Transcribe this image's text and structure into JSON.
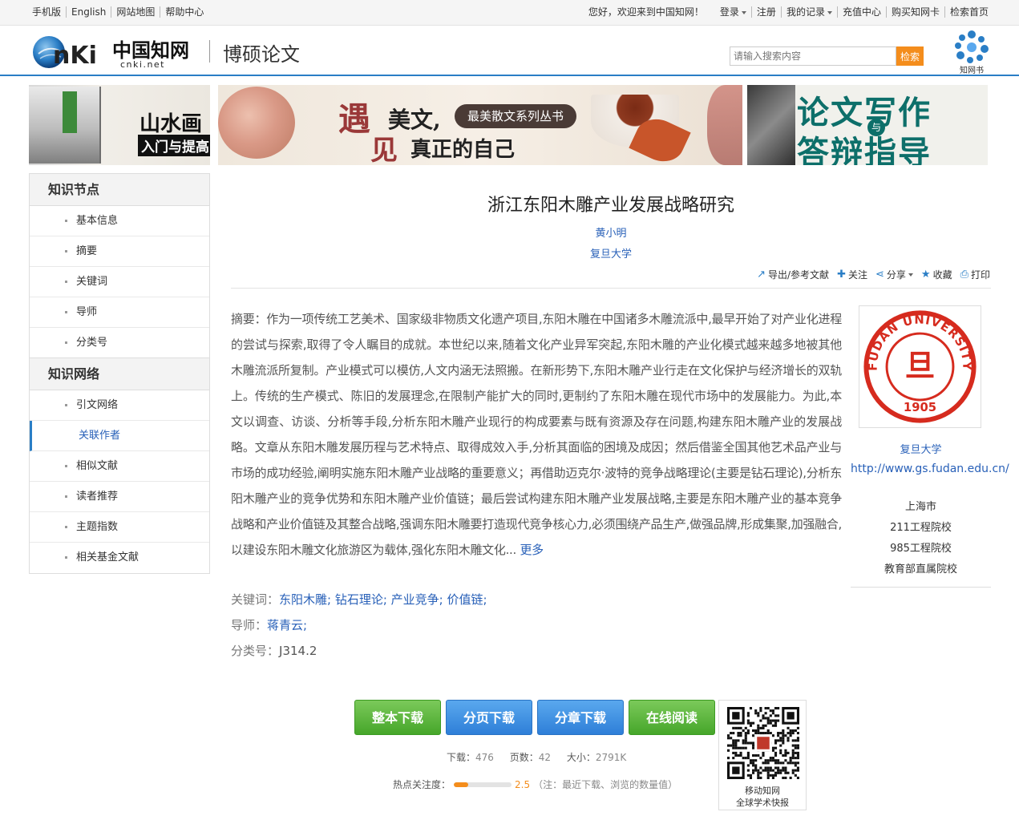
{
  "topbar": {
    "left_links": [
      "手机版",
      "English",
      "网站地图",
      "帮助中心"
    ],
    "greeting": "您好，欢迎来到中国知网！",
    "right_links": [
      {
        "label": "登录",
        "dropdown": true
      },
      {
        "label": "注册",
        "dropdown": false
      },
      {
        "label": "我的记录",
        "dropdown": true
      },
      {
        "label": "充值中心",
        "dropdown": false
      },
      {
        "label": "购买知网卡",
        "dropdown": false
      },
      {
        "label": "检索首页",
        "dropdown": false
      }
    ]
  },
  "header": {
    "logo_text": "CNKi中国知网",
    "logo_sub": "cnki.net",
    "section_title": "博硕论文",
    "search_placeholder": "请输入搜索内容",
    "search_button": "检索",
    "app_logo_text": "知网书"
  },
  "banners": {
    "b1_title": "山水画",
    "b1_sub": "入门与提高",
    "b2_yu": "遇",
    "b2_mw": "美文,",
    "b2_jian": "见",
    "b2_zj": "真正的自己",
    "b2_tag": "最美散文系列丛书",
    "b3_line1": "论文写作",
    "b3_line2": "答辩指导",
    "b3_yu": "与"
  },
  "nav": {
    "group1": "知识节点",
    "group1_items": [
      "基本信息",
      "摘要",
      "关键词",
      "导师",
      "分类号"
    ],
    "group2": "知识网络",
    "group2_items": [
      "引文网络",
      "关联作者",
      "相似文献",
      "读者推荐",
      "主题指数",
      "相关基金文献"
    ],
    "active": "关联作者"
  },
  "article": {
    "title": "浙江东阳木雕产业发展战略研究",
    "author": "黄小明",
    "org": "复旦大学",
    "tools": [
      "导出/参考文献",
      "关注",
      "分享",
      "收藏",
      "打印"
    ],
    "abstract_label": "摘要：",
    "abstract": "作为一项传统工艺美术、国家级非物质文化遗产项目,东阳木雕在中国诸多木雕流派中,最早开始了对产业化进程的尝试与探索,取得了令人瞩目的成就。本世纪以来,随着文化产业异军突起,东阳木雕的产业化模式越来越多地被其他木雕流派所复制。产业模式可以模仿,人文内涵无法照搬。在新形势下,东阳木雕产业行走在文化保护与经济增长的双轨上。传统的生产模式、陈旧的发展理念,在限制产能扩大的同时,更制约了东阳木雕在现代市场中的发展能力。为此,本文以调查、访谈、分析等手段,分析东阳木雕产业现行的构成要素与既有资源及存在问题,构建东阳木雕产业的发展战略。文章从东阳木雕发展历程与艺术特点、取得成效入手,分析其面临的困境及成因；然后借鉴全国其他艺术品产业与市场的成功经验,阐明实施东阳木雕产业战略的重要意义；再借助迈克尔·波特的竞争战略理论(主要是钻石理论),分析东阳木雕产业的竞争优势和东阳木雕产业价值链；最后尝试构建东阳木雕产业发展战略,主要是东阳木雕产业的基本竞争战略和产业价值链及其整合战略,强调东阳木雕要打造现代竞争核心力,必须围绕产品生产,做强品牌,形成集聚,加强融合,以建设东阳木雕文化旅游区为载体,强化东阳木雕文化...",
    "more": "更多",
    "keywords_label": "关键词：",
    "keywords": "东阳木雕; 钻石理论; 产业竞争; 价值链;",
    "advisor_label": "导师：",
    "advisor": "蒋青云;",
    "class_label": "分类号：",
    "class_code": "J314.2"
  },
  "school": {
    "name": "复旦大学",
    "url": "http://www.gs.fudan.edu.cn/",
    "city": "上海市",
    "tag1": "211工程院校",
    "tag2": "985工程院校",
    "tag3": "教育部直属院校",
    "logo_text": "FUDAN UNIVERSITY",
    "logo_year": "1905"
  },
  "download": {
    "buttons": [
      "整本下载",
      "分页下载",
      "分章下载",
      "在线阅读"
    ],
    "downloads_label": "下载：",
    "downloads": "476",
    "pages_label": "页数：",
    "pages": "42",
    "size_label": "大小：",
    "size": "2791K",
    "heat_label": "热点关注度：",
    "heat_value": "2.5",
    "heat_fraction": 0.25,
    "heat_note": "（注：最近下载、浏览的数量值）",
    "qr_caption1": "移动知网",
    "qr_caption2": "全球学术快报"
  },
  "colors": {
    "link_blue": "#2860b8",
    "accent_blue": "#2a7ec6",
    "orange": "#f48d1c",
    "green_button": "#46a62a",
    "blue_button": "#2e7fd8"
  }
}
